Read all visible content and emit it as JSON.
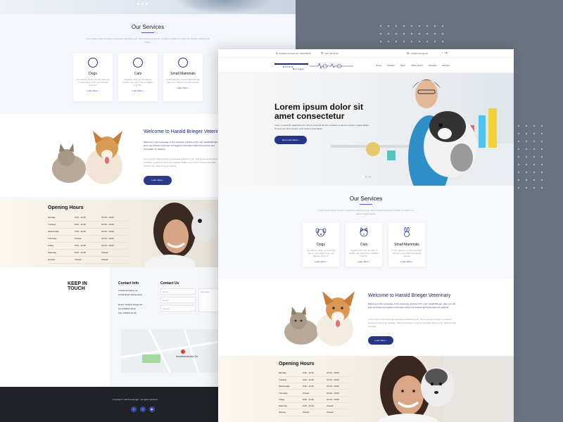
{
  "colors": {
    "accent": "#263684",
    "background": "#6b7280",
    "link": "#2f3a8f"
  },
  "front": {
    "topbar": {
      "address": "Anhaltinerstrasse 3a, 14163 Berlin",
      "phone": "030 / 80 19 32",
      "email": "info@dr-brieger.de",
      "social_icons": [
        "facebook-icon",
        "twitter-icon",
        "youtube-icon"
      ]
    },
    "logo": {
      "line1": "Harald",
      "line2": "Brieger"
    },
    "nav": [
      "Home",
      "Practice",
      "Team",
      "Office Hours",
      "Services",
      "Contact"
    ],
    "hero": {
      "title": "Lorem ipsum dolor sit amet consectetur",
      "text": "Amet, consectetur adipisicing elit. Sed ut eiusmod tempor incididunt ut labore et dolore magna aliqua. Ut enim ad minim veniam, quis nostrud exercitation.",
      "button": "More information ›"
    },
    "services": {
      "title": "Our Services",
      "subtitle": "Lorem ipsum dolor sit amet, consectetur adipisicing elit. Sed ut eiusmod tempor incididunt ut labore et dolore magna aliqua.",
      "cards": [
        {
          "icon": "dog-icon",
          "name": "Dogs",
          "text": "You want to clean your life with one or more dogs or are you already doing it?",
          "link": "Learn More ›"
        },
        {
          "icon": "cat-icon",
          "name": "Cats",
          "text": "Together with you we want to enable your cat to live a healthy, long life.",
          "link": "Learn More ›"
        },
        {
          "icon": "rabbit-icon",
          "name": "Small Mammals",
          "text": "In the category 'small mammals' fall many very different animal species.",
          "link": "Learn More ›"
        }
      ]
    },
    "welcome": {
      "title": "Welcome to Harald Brieger Veterinary",
      "p1": "Welcome to the homepage of the veterinary practice of Dr. med. Harald Brieger. Here you will learn and have put together information about the practice and information for patients.",
      "p2": "Lorem ipsum dolor sit amet consectetur adipisicing elit. Sed ut eiusmod tempor. Curabitur posuere in purus vel molestie. Nulla purus ipsum, tempus imperdiet ultricies non, eleifend eget molestie.",
      "button": "Learn More ›"
    },
    "hours": {
      "title": "Opening Hours",
      "rows": [
        [
          "Monday",
          "9:30 - 11:00",
          "16:30 - 19:00"
        ],
        [
          "Tuesday",
          "9:30 - 11:00",
          "16:30 - 19:00"
        ],
        [
          "Wednesday",
          "9:30 - 11:00",
          "16:30 - 19:00"
        ],
        [
          "Thursday",
          "Closed",
          "16:30 - 19:00"
        ],
        [
          "Friday",
          "9:30 - 11:00",
          "16:30 - 19:00"
        ],
        [
          "Saturday",
          "9:30 - 11:00",
          "Closed"
        ],
        [
          "Sunday",
          "Closed",
          "Closed"
        ]
      ]
    }
  },
  "back": {
    "services_title": "Our Services",
    "services_sub": "Lorem ipsum dolor sit amet, consectetur adipisicing elit. Sed ut eiusmod tempor. Curabitur posuere in purus vel molestie. Nulla purus ipsum.",
    "cards": [
      {
        "name": "Dogs",
        "text": "You want to clean your life with one or more dogs or are you already doing it?",
        "link": "Learn More ›"
      },
      {
        "name": "Cats",
        "text": "Together with you we want to enable your cat to live a healthy, long life.",
        "link": "Learn More ›"
      },
      {
        "name": "Small Mammals",
        "text": "In the category 'small mammals' fall many very different animal species.",
        "link": "Learn More ›"
      }
    ],
    "welcome_title": "Welcome to Harald Brieger Veterinary",
    "welcome_p1": "Welcome to the homepage of the veterinary practice of Dr. med. Harald Brieger. Here you will learn and have put together information about the practice and information for patients.",
    "welcome_p2": "Lorem ipsum dolor sit amet consectetur adipisicing elit. Sed ut eiusmod tempor. Curabitur posuere in purus vel molestie. Nulla purus ipsum, tempus imperdiet ultricies non, eleifend eget molestie.",
    "welcome_button": "Learn More ›",
    "hours_title": "Opening Hours",
    "keep_in_touch": "KEEP IN TOUCH",
    "contact_info_title": "Contact Info",
    "contact_address": "Anhaltinerstrasse 3a\n14163 Berlin (Zehlendorf)",
    "contact_email": "Email: info@dr-brieger.de",
    "contact_tel": "Tel: 030/801 58 52",
    "contact_fax": "Fax: 030/802 21 36",
    "contact_us_title": "Contact Us",
    "form": {
      "name": "Name*",
      "email": "Email*",
      "subject": "Subject",
      "message": "Message"
    },
    "map_label": "Anhaltinerstraße 3a",
    "copyright": "Copyright © 2018 dr-brieger . All rights reserved.",
    "footer_social": [
      "facebook-icon",
      "twitter-icon",
      "youtube-icon"
    ]
  }
}
